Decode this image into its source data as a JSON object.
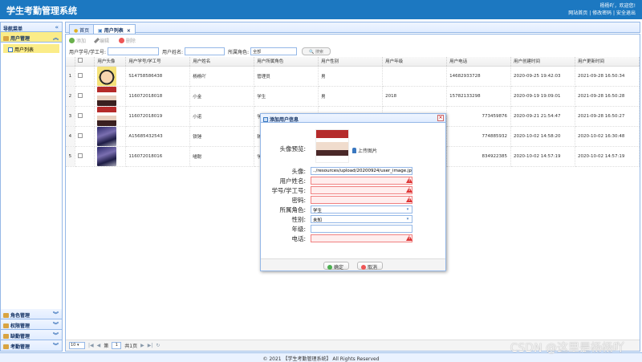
{
  "header": {
    "title": "学生考勤管理系统",
    "greeting": "杨杨吖，欢迎您!",
    "links": [
      "网站首页",
      "修改密码",
      "安全退出"
    ]
  },
  "sidebar": {
    "title": "导航菜单",
    "groups": [
      {
        "label": "用户管理",
        "items": [
          "用户列表"
        ]
      },
      {
        "label": "角色管理"
      },
      {
        "label": "权限管理"
      },
      {
        "label": "缺勤管理"
      },
      {
        "label": "考勤管理"
      }
    ]
  },
  "tabs": [
    {
      "label": "首页"
    },
    {
      "label": "用户列表",
      "close": "×"
    }
  ],
  "toolbar": {
    "add": "添加",
    "edit": "编辑",
    "delete": "删除"
  },
  "search": {
    "id_label": "用户学号/学工号:",
    "name_label": "用户姓名:",
    "role_label": "所属角色:",
    "role_value": "全部",
    "button": "搜索"
  },
  "grid": {
    "headers": [
      "用户头像",
      "用户学号/学工号",
      "用户姓名",
      "用户所属角色",
      "用户性别",
      "用户年级",
      "用户电话",
      "用户创建时间",
      "用户更新时间"
    ],
    "rows": [
      {
        "num": "1",
        "id": "S14758586438",
        "name": "杨杨吖",
        "role": "管理员",
        "gender": "男",
        "grade": "",
        "phone": "14682933728",
        "created": "2020-09-25 19:42:03",
        "updated": "2021-09-28 16:50:34"
      },
      {
        "num": "2",
        "id": "116072018018",
        "name": "小金",
        "role": "学生",
        "gender": "男",
        "grade": "2018",
        "phone": "15782133298",
        "created": "2020-09-19 19:09:01",
        "updated": "2021-09-28 16:50:28"
      },
      {
        "num": "3",
        "id": "116072018019",
        "name": "小诺",
        "role": "学",
        "gender": "",
        "grade": "",
        "phone": "773459876",
        "created": "2020-09-21 21:54:47",
        "updated": "2021-09-28 16:50:27"
      },
      {
        "num": "4",
        "id": "A15685432543",
        "name": "铁锤",
        "role": "辅",
        "gender": "",
        "grade": "",
        "phone": "774885932",
        "created": "2020-10-02 14:58:20",
        "updated": "2020-10-02 16:30:48"
      },
      {
        "num": "5",
        "id": "116072018016",
        "name": "喵聪",
        "role": "学",
        "gender": "",
        "grade": "",
        "phone": "834922385",
        "created": "2020-10-02 14:57:19",
        "updated": "2020-10-02 14:57:19"
      }
    ]
  },
  "pager": {
    "page_size": "10",
    "page_prefix": "第",
    "page_value": "1",
    "page_suffix": "共1页"
  },
  "dialog": {
    "title": "添加用户信息",
    "close": "×",
    "preview_label": "头像预览:",
    "upload_label": "上传图片",
    "avatar_label": "头像:",
    "avatar_value": "../resources/upload/20200924/user_image.jpg",
    "name_label": "用户姓名:",
    "id_label": "学号/学工号:",
    "password_label": "密码:",
    "role_label": "所属角色:",
    "role_value": "学生",
    "gender_label": "性别:",
    "gender_value": "未知",
    "grade_label": "年级:",
    "phone_label": "电话:",
    "ok": "确定",
    "cancel": "取消"
  },
  "footer": {
    "text": "© 2021 【学生考勤管理系统】 All Rights Reserved"
  },
  "watermark": "CSDN @这里是杨杨吖",
  "colors": {
    "header": "#1c78c1",
    "selected": "#fbec88",
    "border": "#95b8e7"
  }
}
